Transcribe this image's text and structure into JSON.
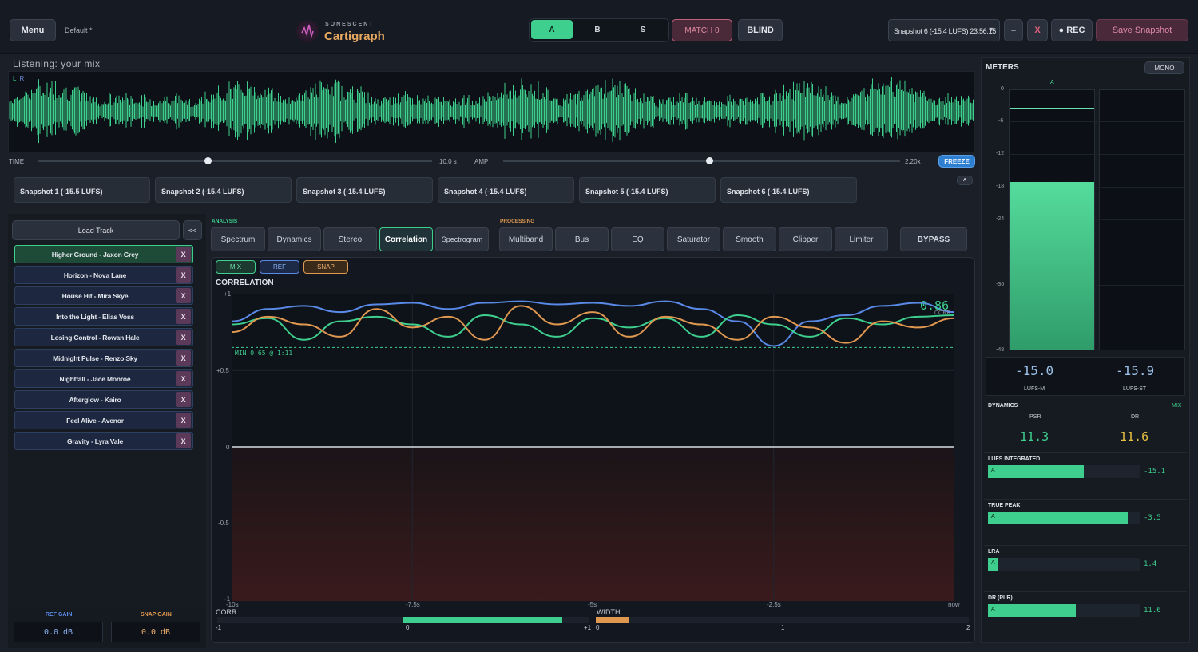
{
  "topbar": {
    "menu_label": "Menu",
    "preset": "Default *",
    "brand_top": "SONESCENT",
    "brand_name": "Cartigraph",
    "ab": [
      "A",
      "B",
      "S"
    ],
    "match_label": "MATCH 0",
    "blind_label": "BLIND",
    "snapshot_select": "Snapshot 6 (-15.4 LUFS) 23:56:15",
    "minus_label": "–",
    "close_label": "X",
    "rec_label": "● REC",
    "save_label": "Save Snapshot"
  },
  "waveform": {
    "listening": "Listening: your mix",
    "channel_l": "L",
    "channel_r": "R",
    "time_label": "TIME",
    "time_value": "10.0 s",
    "time_fraction": 0.43,
    "amp_label": "AMP",
    "amp_value": "2.20x",
    "amp_fraction": 0.52,
    "freeze_label": "FREEZE",
    "color": "#3ecf8e"
  },
  "snapshots": [
    "Snapshot 1 (-15.5 LUFS)",
    "Snapshot 2 (-15.4 LUFS)",
    "Snapshot 3 (-15.4 LUFS)",
    "Snapshot 4 (-15.4 LUFS)",
    "Snapshot 5 (-15.4 LUFS)",
    "Snapshot 6 (-15.4 LUFS)"
  ],
  "snapshot_collapse": "˄",
  "tracks": {
    "load_label": "Load Track",
    "collapse_label": "<<",
    "remove_label": "X",
    "items": [
      "Higher Ground - Jaxon Grey",
      "Horizon - Nova Lane",
      "House Hit - Mira Skye",
      "Into the Light - Elias Voss",
      "Losing Control - Rowan Hale",
      "Midnight Pulse - Renzo Sky",
      "Nightfall - Jace Monroe",
      "Afterglow - Kairo",
      "Feel Alive - Avenor",
      "Gravity - Lyra Vale"
    ]
  },
  "gain": {
    "ref_label": "REF GAIN",
    "ref_value": "0.0 dB",
    "snap_label": "SNAP GAIN",
    "snap_value": "0.0 dB"
  },
  "tabs": {
    "analysis_label": "ANALYSIS",
    "processing_label": "PROCESSING",
    "analysis": [
      "Spectrum",
      "Dynamics",
      "Stereo",
      "Correlation",
      "Spectrogram"
    ],
    "processing": [
      "Multiband",
      "Bus",
      "EQ",
      "Saturator",
      "Smooth",
      "Clipper",
      "Limiter"
    ],
    "bypass_label": "BYPASS"
  },
  "legend": {
    "mix": "MIX",
    "ref": "REF",
    "snap": "SNAP"
  },
  "correlation": {
    "title": "CORRELATION",
    "value": "0.86",
    "value_label": "CORR",
    "min_label": "MIN 0.65 @ 1:11",
    "min_value": 0.65,
    "y_ticks": [
      "+1",
      "+0.5",
      "0",
      "-0.5",
      "-1"
    ],
    "x_ticks": [
      "-10s",
      "-7.5s",
      "-5s",
      "-2.5s",
      "now"
    ]
  },
  "chart_data": {
    "type": "line",
    "x": [
      -10,
      -9.5,
      -9,
      -8.5,
      -8,
      -7.5,
      -7,
      -6.5,
      -6,
      -5.5,
      -5,
      -4.5,
      -4,
      -3.5,
      -3,
      -2.5,
      -2,
      -1.5,
      -1,
      -0.5,
      0
    ],
    "series": [
      {
        "color": "#5a8ae8",
        "values": [
          0.82,
          0.9,
          0.92,
          0.88,
          0.93,
          0.94,
          0.9,
          0.94,
          0.95,
          0.93,
          0.94,
          0.92,
          0.95,
          0.9,
          0.82,
          0.66,
          0.82,
          0.86,
          0.92,
          0.94,
          0.88
        ]
      },
      {
        "color": "#3ecf8e",
        "values": [
          0.8,
          0.84,
          0.7,
          0.82,
          0.85,
          0.8,
          0.72,
          0.86,
          0.8,
          0.72,
          0.84,
          0.78,
          0.84,
          0.72,
          0.86,
          0.8,
          0.72,
          0.84,
          0.8,
          0.85,
          0.86
        ]
      },
      {
        "color": "#e09850",
        "values": [
          0.75,
          0.85,
          0.8,
          0.72,
          0.9,
          0.78,
          0.85,
          0.7,
          0.92,
          0.8,
          0.88,
          0.72,
          0.85,
          0.8,
          0.7,
          0.85,
          0.78,
          0.68,
          0.82,
          0.78,
          0.84
        ]
      }
    ],
    "ylim": [
      -1,
      1
    ],
    "xlim": [
      -10,
      0
    ]
  },
  "bottom": {
    "corr_label": "CORR",
    "corr_ticks": [
      "-1",
      "0",
      "+1"
    ],
    "corr_value": 0.86,
    "width_label": "WIDTH",
    "width_ticks": [
      "0",
      "1",
      "2"
    ],
    "width_value": 0.09
  },
  "meters": {
    "title": "METERS",
    "mono_label": "MONO",
    "channel": "A",
    "scale": [
      "0",
      "-6",
      "-12",
      "-18",
      "-24",
      "-36",
      "-48"
    ],
    "lufs_m": "-15.0",
    "lufs_m_label": "LUFS-M",
    "lufs_st": "-15.9",
    "lufs_st_label": "LUFS-ST",
    "dynamics_label": "DYNAMICS",
    "dynamics_mode": "MIX",
    "psr_label": "PSR",
    "psr_value": "11.3",
    "dr_label": "DR",
    "dr_value": "11.6",
    "stats": [
      {
        "label": "LUFS INTEGRATED",
        "tag": "A",
        "value": "-15.1",
        "fraction": 0.63
      },
      {
        "label": "TRUE PEAK",
        "tag": "A",
        "value": "-3.5",
        "fraction": 0.92
      },
      {
        "label": "LRA",
        "tag": "A",
        "value": "1.4",
        "fraction": 0.07
      },
      {
        "label": "DR (PLR)",
        "tag": "A",
        "value": "11.6",
        "fraction": 0.58
      }
    ]
  }
}
